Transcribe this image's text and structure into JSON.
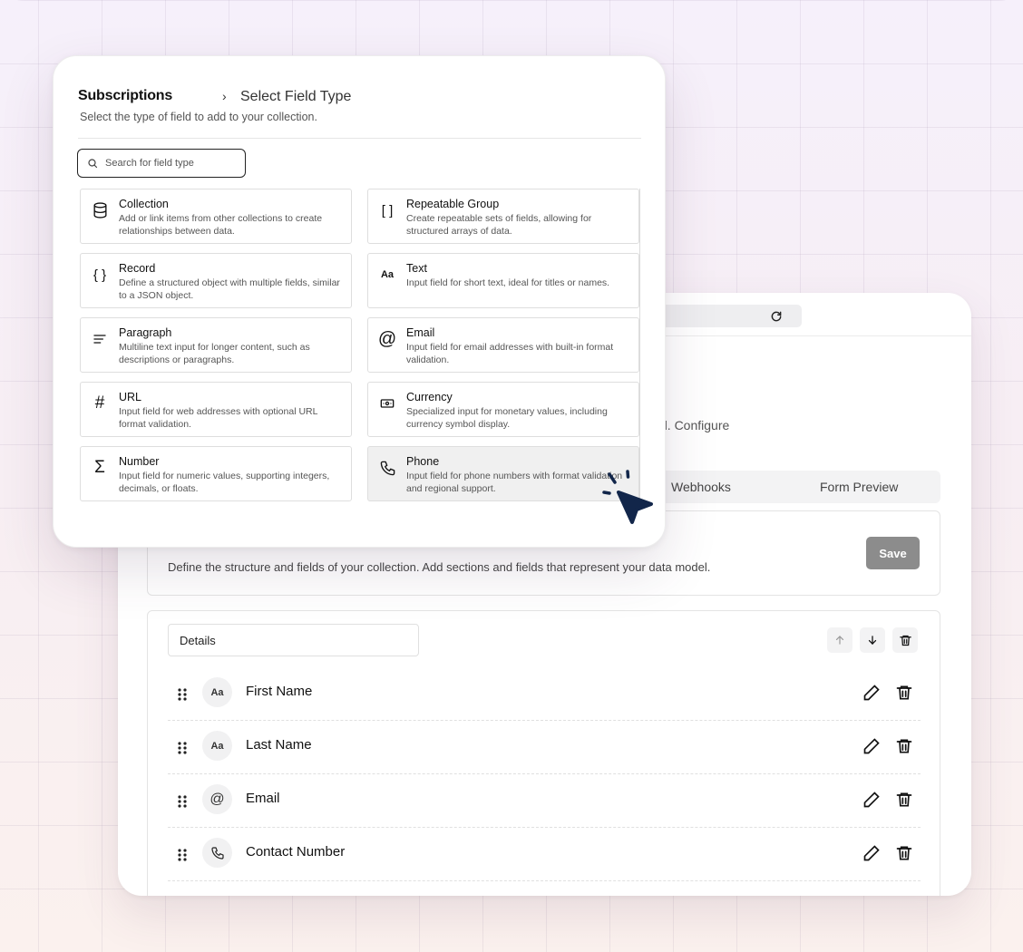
{
  "back_window": {
    "description_fragment": "d. Configure",
    "tabs": [
      "Webhooks",
      "Form Preview"
    ],
    "section_description": "Define the structure and fields of your collection. Add sections and fields that represent your data model.",
    "save_label": "Save",
    "section_title_value": "Details",
    "fields": [
      {
        "name": "First Name",
        "type_icon": "text-type-icon",
        "badge": "Aa"
      },
      {
        "name": "Last Name",
        "type_icon": "text-type-icon",
        "badge": "Aa"
      },
      {
        "name": "Email",
        "type_icon": "at-icon",
        "badge": "@"
      },
      {
        "name": "Contact Number",
        "type_icon": "phone-icon",
        "badge": ""
      }
    ]
  },
  "modal": {
    "breadcrumb_root": "Subscriptions",
    "breadcrumb_sep": "›",
    "title": "Select Field Type",
    "subtitle": "Select the type of field to add to your collection.",
    "search_placeholder": "Search for field type",
    "field_types": [
      {
        "name": "Collection",
        "icon": "database-icon",
        "desc": "Add or link items from other collections to create relationships between data."
      },
      {
        "name": "Repeatable Group",
        "icon": "brackets-icon",
        "glyph": "[ ]",
        "desc": "Create repeatable sets of fields, allowing for structured arrays of data."
      },
      {
        "name": "Record",
        "icon": "braces-icon",
        "glyph": "{ }",
        "desc": "Define a structured object with multiple fields, similar to a JSON object."
      },
      {
        "name": "Text",
        "icon": "text-type-icon",
        "glyph": "Aa",
        "desc": "Input field for short text, ideal for titles or names."
      },
      {
        "name": "Paragraph",
        "icon": "paragraph-icon",
        "desc": "Multiline text input for longer content, such as descriptions or paragraphs."
      },
      {
        "name": "Email",
        "icon": "at-icon",
        "glyph": "@",
        "desc": "Input field for email addresses with built-in format validation."
      },
      {
        "name": "URL",
        "icon": "hash-icon",
        "glyph": "#",
        "desc": "Input field for web addresses with optional URL format validation."
      },
      {
        "name": "Currency",
        "icon": "banknote-icon",
        "desc": "Specialized input for monetary values, including currency symbol display."
      },
      {
        "name": "Number",
        "icon": "sigma-icon",
        "glyph": "Σ",
        "desc": "Input field for numeric values, supporting integers, decimals, or floats."
      },
      {
        "name": "Phone",
        "icon": "phone-icon",
        "desc": "Input field for phone numbers with format validation and regional support."
      }
    ]
  },
  "colors": {
    "cursor": "#12264a",
    "save_button": "#8c8c8c",
    "active_card": "#f0f0f0"
  }
}
